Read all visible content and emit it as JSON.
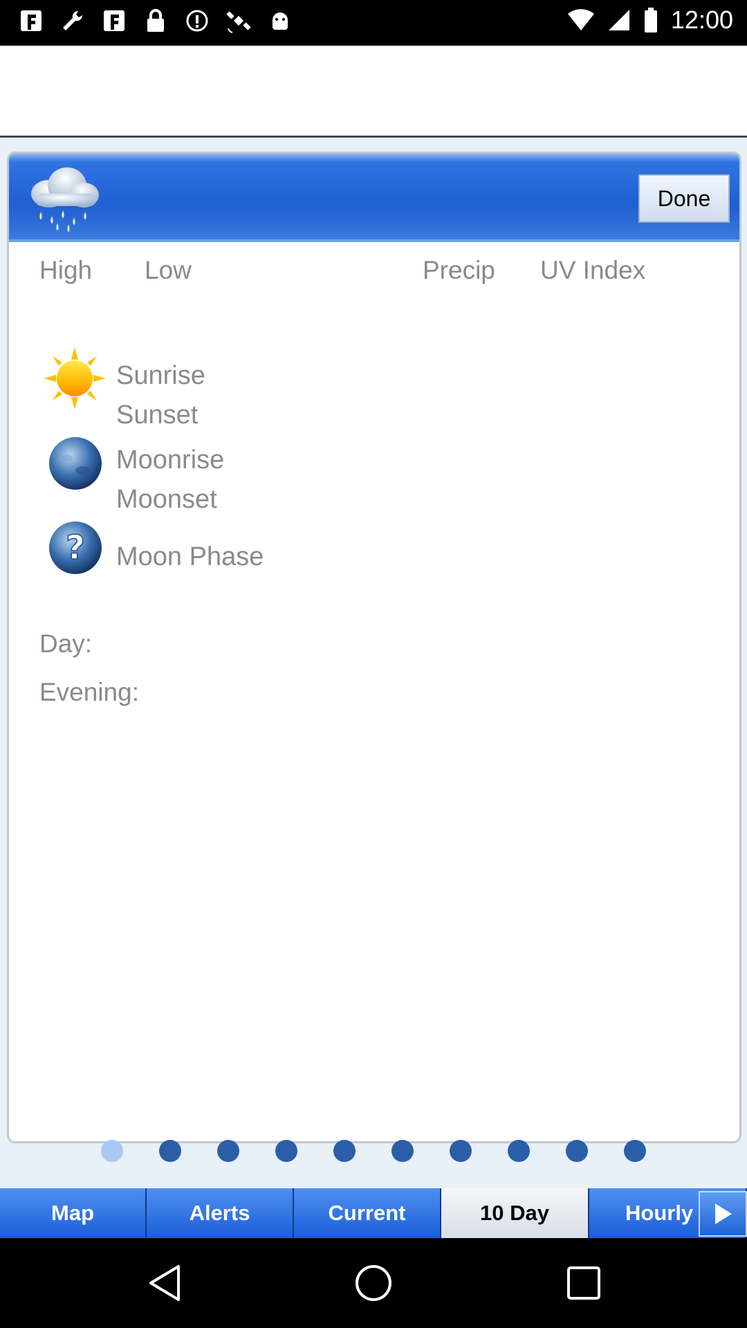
{
  "status_bar": {
    "time": "12:00",
    "icons": [
      "notification-f-icon",
      "wrench-icon",
      "notification-f-icon",
      "lock-icon",
      "info-circle-icon",
      "satellite-icon",
      "android-icon"
    ]
  },
  "header": {
    "done_label": "Done"
  },
  "columns": {
    "high": "High",
    "low": "Low",
    "precip": "Precip",
    "uv_index": "UV Index"
  },
  "astro": {
    "sunrise": "Sunrise",
    "sunset": "Sunset",
    "moonrise": "Moonrise",
    "moonset": "Moonset",
    "moon_phase": "Moon Phase"
  },
  "forecast": {
    "day": "Day:",
    "evening": "Evening:"
  },
  "pager": {
    "count": 10,
    "active_index": 0
  },
  "tabs": [
    {
      "label": "Map"
    },
    {
      "label": "Alerts"
    },
    {
      "label": "Current"
    },
    {
      "label": "10 Day",
      "selected": true
    },
    {
      "label": "Hourly"
    }
  ]
}
